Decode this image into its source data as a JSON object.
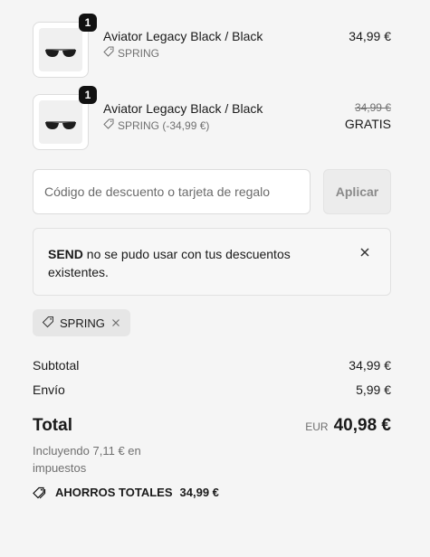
{
  "line_items": [
    {
      "quantity": "1",
      "title": "Aviator Legacy Black / Black",
      "discount_label": "SPRING",
      "price": "34,99 €",
      "product_image": "aviator-sunglasses-image",
      "tag_icon": "tag-icon"
    },
    {
      "quantity": "1",
      "title": "Aviator Legacy Black / Black",
      "discount_label": "SPRING (-34,99 €)",
      "original_price": "34,99 €",
      "price": "GRATIS",
      "product_image": "aviator-sunglasses-image",
      "tag_icon": "tag-icon"
    }
  ],
  "discount": {
    "placeholder": "Código de descuento o tarjeta de regalo",
    "value": "",
    "apply_label": "Aplicar"
  },
  "alert": {
    "code": "SEND",
    "message": " no se pudo usar con tus descuentos existentes.",
    "close_icon": "close-icon"
  },
  "applied_code": {
    "label": "SPRING",
    "tag_icon": "tag-icon",
    "remove_icon": "close-icon"
  },
  "summary": {
    "subtotal_label": "Subtotal",
    "subtotal_value": "34,99 €",
    "shipping_label": "Envío",
    "shipping_value": "5,99 €",
    "total_label": "Total",
    "currency": "EUR",
    "total_value": "40,98 €",
    "tax_note": "Incluyendo 7,11 € en impuestos",
    "savings_label": "AHORROS TOTALES",
    "savings_value": "34,99 €",
    "savings_icon": "tags-icon"
  },
  "colors": {
    "background": "#f5f5f5",
    "text": "#1a1a1a",
    "muted": "#707070",
    "badge": "#111111"
  }
}
